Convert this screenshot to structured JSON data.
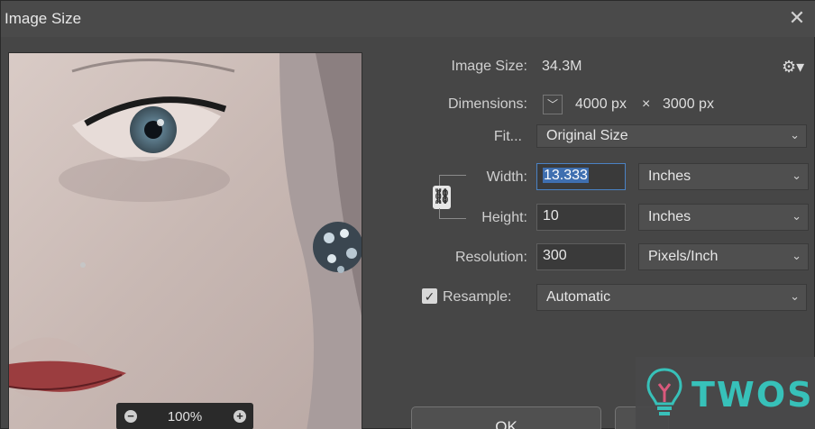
{
  "window": {
    "title": "Image Size",
    "close_glyph": "✕"
  },
  "info": {
    "image_size_label": "Image Size:",
    "image_size_value": "34.3M",
    "dimensions_label": "Dimensions:",
    "dimensions_width": "4000 px",
    "dimensions_sep": "×",
    "dimensions_height": "3000 px"
  },
  "fields": {
    "fit_label": "Fit...",
    "fit_value": "Original Size",
    "width_label": "Width:",
    "width_value": "13.333",
    "width_unit": "Inches",
    "height_label": "Height:",
    "height_value": "10",
    "height_unit": "Inches",
    "resolution_label": "Resolution:",
    "resolution_value": "300",
    "resolution_unit": "Pixels/Inch",
    "resample_label": "Resample:",
    "resample_checked": true,
    "resample_value": "Automatic"
  },
  "preview": {
    "zoom": "100%"
  },
  "buttons": {
    "ok": "OK"
  },
  "watermark": {
    "text": "TWOS"
  },
  "icons": {
    "settings": "gear-icon",
    "link": "chain-link-icon",
    "close": "close-icon",
    "zoom_out": "minus-circle-icon",
    "zoom_in": "plus-circle-icon"
  },
  "colors": {
    "background": "#464646",
    "accent": "#3f6fb0",
    "watermark": "#37c8c0"
  }
}
